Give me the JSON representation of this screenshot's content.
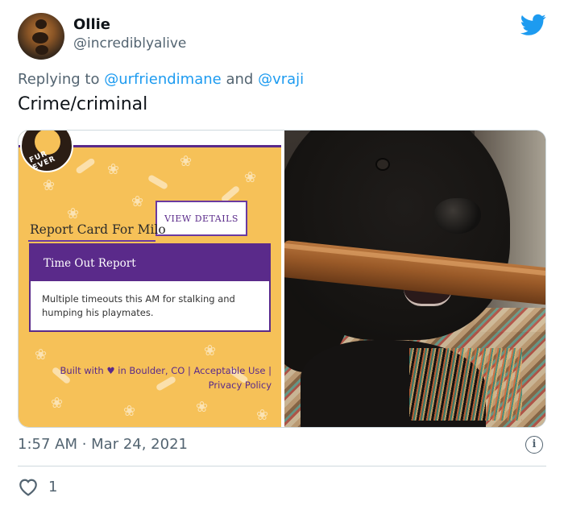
{
  "user": {
    "name": "Ollie",
    "handle": "@incrediblyalive",
    "avatar_icon": "avatar-photo"
  },
  "reply": {
    "prefix": "Replying to",
    "mention1": "@urfriendimane",
    "joiner": "and",
    "mention2": "@vraji"
  },
  "tweet": {
    "text": "Crime/criminal"
  },
  "report_card": {
    "logo_text": "FUR EVER",
    "view_details": "VIEW DETAILS",
    "title": "Report Card For Milo",
    "section_title": "Time Out Report",
    "section_body": "Multiple timeouts this AM for stalking and humping his playmates.",
    "footer_line1_a": "Built with",
    "footer_heart": "♥",
    "footer_line1_b": "in Boulder, CO | Acceptable Use |",
    "footer_line2": "Privacy Policy"
  },
  "meta": {
    "timestamp": "1:57 AM · Mar 24, 2021",
    "info_icon": "i"
  },
  "actions": {
    "like_count": "1"
  },
  "colors": {
    "twitter_blue": "#1d9bf0",
    "purple": "#5a2a8a",
    "yellow": "#f6c158",
    "muted": "#536471"
  }
}
